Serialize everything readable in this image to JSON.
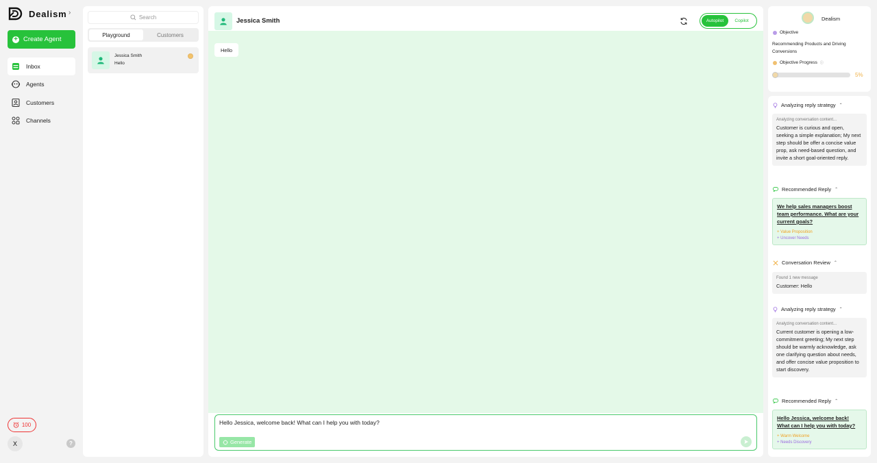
{
  "app": {
    "name": "Dealism"
  },
  "nav": {
    "create_label": "Create Agent",
    "items": [
      {
        "label": "Inbox",
        "icon": "inbox-icon",
        "active": true
      },
      {
        "label": "Agents",
        "icon": "agent-icon",
        "active": false
      },
      {
        "label": "Customers",
        "icon": "contact-icon",
        "active": false
      },
      {
        "label": "Channels",
        "icon": "channels-icon",
        "active": false
      }
    ],
    "credits": "100",
    "user_initial": "X",
    "help": "?"
  },
  "list": {
    "search_placeholder": "Search",
    "tabs": [
      "Playground",
      "Customers"
    ],
    "active_tab": "Playground",
    "conversations": [
      {
        "name": "Jessica Smith",
        "last_message": "Hello"
      }
    ]
  },
  "chat": {
    "contact_name": "Jessica Smith",
    "modes": [
      "Autopilot",
      "Copilot"
    ],
    "active_mode": "Autopilot",
    "messages": [
      {
        "from": "customer",
        "text": "Hello"
      }
    ],
    "composer_text": "Hello Jessica, welcome back! What can I help you with today?",
    "generate_label": "Generate"
  },
  "agent": {
    "name": "Dealism",
    "objective_label": "Objective",
    "objective_text": "Recommending Products and Driving Conversions",
    "progress_label": "Objective Progress",
    "progress_info": "ⓘ",
    "progress_value": "5%",
    "progress_fraction": 0.05
  },
  "log": {
    "s1_title": "Analyzing reply strategy",
    "s1_small": "Analyzing conversation content...",
    "s1_body": "Customer is curious and open, seeking a simple explanation; My next step should be offer a concise value prop, ask need-based question, and invite a short goal-oriented reply.",
    "s2_title": "Recommended Reply",
    "s2_reply": "We help sales managers boost team performance.  What are your current goals?",
    "s2_tag1": "Value Proposition",
    "s2_tag2": "Uncover Needs",
    "s3_title": "Conversation Review",
    "s3_small": "Found 1 new message",
    "s3_body": "Customer: Hello",
    "s4_title": "Analyzing reply strategy",
    "s4_small": "Analyzing conversation content...",
    "s4_body": "Current customer is opening a low-commitment greeting; My next step should be warmly acknowledge, ask one clarifying question about needs, and offer concise value proposition to start discovery.",
    "s5_title": "Recommended Reply",
    "s5_reply": "Hello Jessica, welcome back! What can I help you with today?",
    "s5_tag1": "Warm Welcome",
    "s5_tag2": "Needs Discovery"
  },
  "colors": {
    "brand_green": "#27c23b",
    "chat_bg": "#e4f9e8",
    "warning_red": "#e33333",
    "progress_orange": "#f0b24a"
  }
}
